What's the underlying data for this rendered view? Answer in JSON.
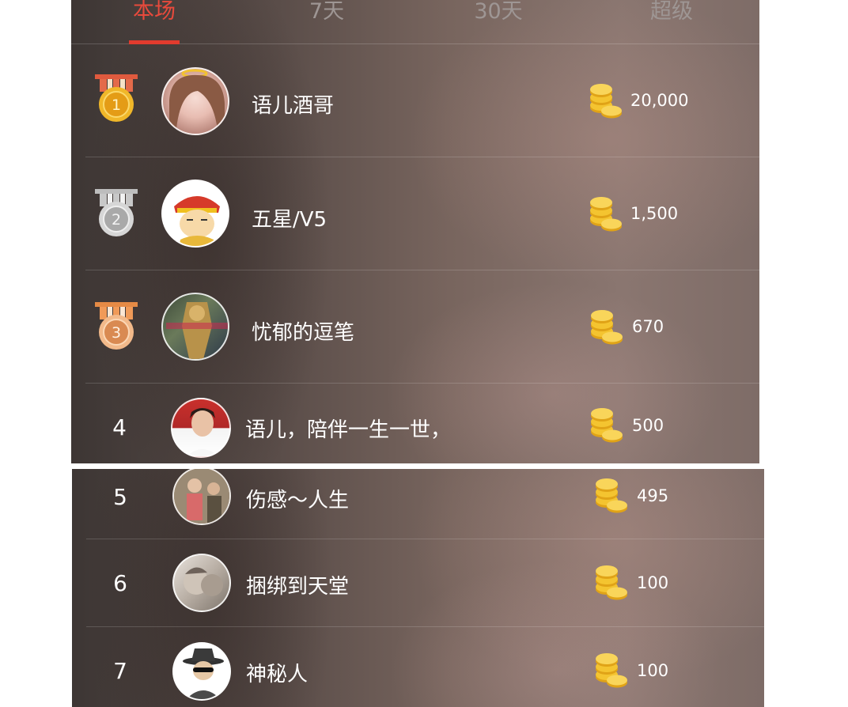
{
  "tabs": [
    {
      "label": "本场",
      "active": true
    },
    {
      "label": "7天",
      "active": false
    },
    {
      "label": "30天",
      "active": false
    },
    {
      "label": "超级",
      "active": false
    }
  ],
  "colors": {
    "accent": "#e23b2e",
    "gold": "#f0b729",
    "silver": "#c9c9c9",
    "bronze": "#e79a5c"
  },
  "leaderboard": [
    {
      "rank": "1",
      "medal": "gold-medal-icon",
      "name": "语儿酒哥",
      "score": "20,000"
    },
    {
      "rank": "2",
      "medal": "silver-medal-icon",
      "name": "五星/V5",
      "score": "1,500"
    },
    {
      "rank": "3",
      "medal": "bronze-medal-icon",
      "name": "忧郁的逗笔",
      "score": "670"
    },
    {
      "rank": "4",
      "medal": null,
      "name": "语儿，陪伴一生一世，",
      "score": "500"
    },
    {
      "rank": "5",
      "medal": null,
      "name": "伤感～人生",
      "score": "495"
    },
    {
      "rank": "6",
      "medal": null,
      "name": "捆绑到天堂",
      "score": "100"
    },
    {
      "rank": "7",
      "medal": null,
      "name": "神秘人",
      "score": "100"
    }
  ]
}
